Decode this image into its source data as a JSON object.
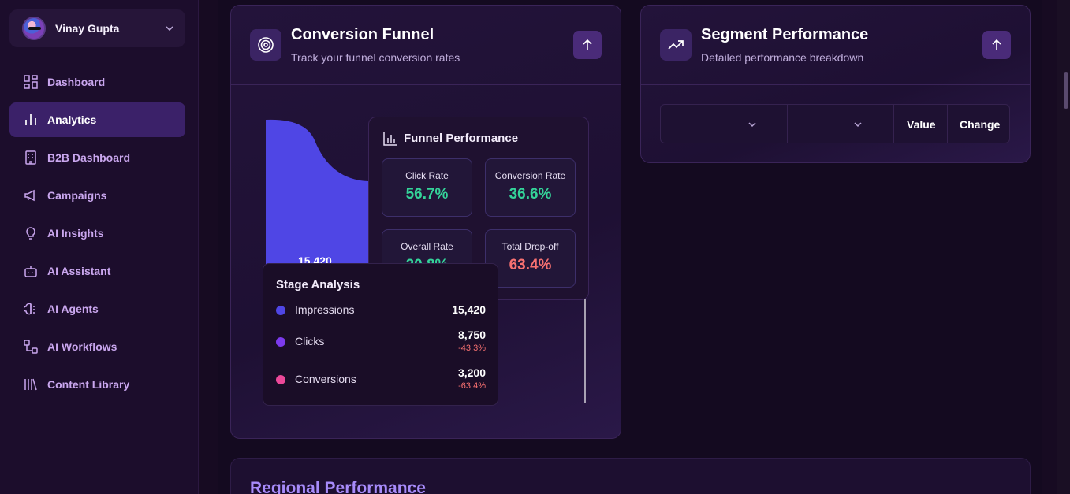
{
  "user": {
    "name": "Vinay Gupta"
  },
  "nav": [
    {
      "label": "Dashboard",
      "icon": "grid-icon",
      "active": false
    },
    {
      "label": "Analytics",
      "icon": "bar-chart-icon",
      "active": true
    },
    {
      "label": "B2B Dashboard",
      "icon": "building-icon",
      "active": false
    },
    {
      "label": "Campaigns",
      "icon": "megaphone-icon",
      "active": false
    },
    {
      "label": "AI Insights",
      "icon": "lightbulb-icon",
      "active": false
    },
    {
      "label": "AI Assistant",
      "icon": "bot-icon",
      "active": false
    },
    {
      "label": "AI Agents",
      "icon": "brain-icon",
      "active": false
    },
    {
      "label": "AI Workflows",
      "icon": "workflow-icon",
      "active": false
    },
    {
      "label": "Content Library",
      "icon": "library-icon",
      "active": false
    }
  ],
  "conversion_funnel": {
    "title": "Conversion Funnel",
    "subtitle": "Track your funnel conversion rates",
    "visible_value": "15,420",
    "performance": {
      "title": "Funnel Performance",
      "metrics": [
        {
          "label": "Click Rate",
          "value": "56.7%"
        },
        {
          "label": "Conversion Rate",
          "value": "36.6%"
        },
        {
          "label": "Overall Rate",
          "value": "20.8%"
        },
        {
          "label": "Total Drop-off",
          "value": "63.4%"
        }
      ]
    },
    "stage_analysis": {
      "title": "Stage Analysis",
      "stages": [
        {
          "name": "Impressions",
          "value": "15,420",
          "change": "",
          "color": "#4f46e5"
        },
        {
          "name": "Clicks",
          "value": "8,750",
          "change": "-43.3%",
          "color": "#7c3aed"
        },
        {
          "name": "Conversions",
          "value": "3,200",
          "change": "-63.4%",
          "color": "#ec4899"
        }
      ]
    }
  },
  "segment_performance": {
    "title": "Segment Performance",
    "subtitle": "Detailed performance breakdown",
    "columns": {
      "value": "Value",
      "change": "Change"
    }
  },
  "regional": {
    "title": "Regional Performance"
  },
  "colors": {
    "accent": "#4f46e5",
    "positive": "#34d399",
    "negative": "#f87171"
  }
}
